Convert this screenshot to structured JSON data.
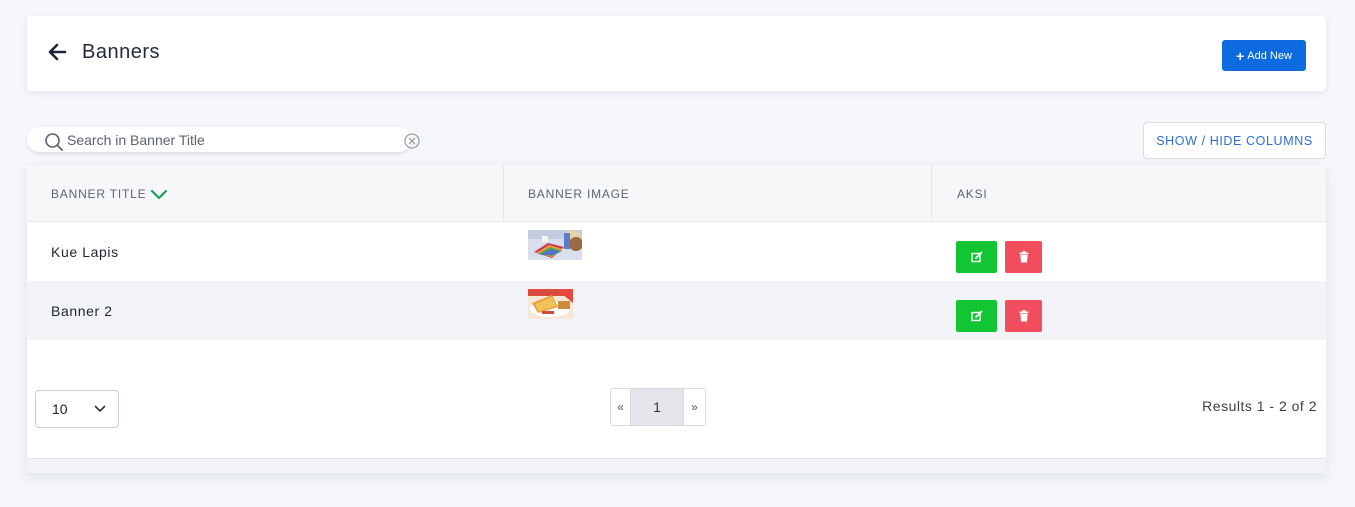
{
  "header": {
    "title": "Banners",
    "back_icon": "arrow-left-icon",
    "add_button_label": "Add New",
    "add_button_icon": "plus-icon",
    "accent_color": "#0d6adf"
  },
  "search": {
    "placeholder": "Search in Banner Title",
    "value": ""
  },
  "columns_button_label": "SHOW / HIDE COLUMNS",
  "table": {
    "headers": [
      "BANNER TITLE",
      "BANNER IMAGE",
      "AKSI"
    ],
    "sort_icon": "chevron-down-icon",
    "rows": [
      {
        "title": "Kue Lapis",
        "image": "banner-thumbnail-kue-lapis"
      },
      {
        "title": "Banner 2",
        "image": "banner-thumbnail-food"
      }
    ],
    "edit_color": "#12c633",
    "delete_color": "#f24d5c"
  },
  "pagination": {
    "per_page": "10",
    "prev": "«",
    "current": "1",
    "next": "»",
    "results": "Results 1 - 2 of 2"
  }
}
